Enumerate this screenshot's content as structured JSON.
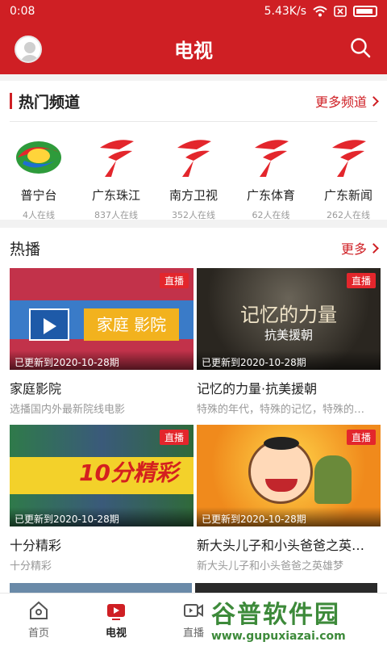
{
  "status": {
    "time": "0:08",
    "speed": "5.43K/s"
  },
  "header": {
    "title": "电视"
  },
  "channels": {
    "title": "热门频道",
    "more": "更多频道",
    "items": [
      {
        "name": "普宁台",
        "count": "4人在线",
        "logo": "puning-logo"
      },
      {
        "name": "广东珠江",
        "count": "837人在线",
        "logo": "gdtv-logo"
      },
      {
        "name": "南方卫视",
        "count": "352人在线",
        "logo": "gdtv-logo"
      },
      {
        "name": "广东体育",
        "count": "62人在线",
        "logo": "gdtv-logo"
      },
      {
        "name": "广东新闻",
        "count": "262人在线",
        "logo": "gdtv-logo"
      }
    ]
  },
  "hot": {
    "title": "热播",
    "more": "更多",
    "live_label": "直播",
    "cards": [
      {
        "title": "家庭影院",
        "desc": "选播国内外最新院线电影",
        "update": "已更新到2020-10-28期",
        "thumb_text": "家庭 影院"
      },
      {
        "title": "记忆的力量·抗美援朝",
        "desc": "特殊的年代，特殊的记忆，特殊的…",
        "update": "已更新到2020-10-28期",
        "thumb_text": "记忆的力量",
        "thumb_sub": "抗美援朝"
      },
      {
        "title": "十分精彩",
        "desc": "十分精彩",
        "update": "已更新到2020-10-28期",
        "thumb_text": "10分精彩"
      },
      {
        "title": "新大头儿子和小头爸爸之英…",
        "desc": "新大头儿子和小头爸爸之英雄梦",
        "update": "已更新到2020-10-28期",
        "thumb_text": ""
      }
    ]
  },
  "tabs": [
    {
      "label": "首页",
      "icon": "home-icon"
    },
    {
      "label": "电视",
      "icon": "tv-icon"
    },
    {
      "label": "直播",
      "icon": "video-icon"
    },
    {
      "label": "",
      "icon": ""
    },
    {
      "label": "",
      "icon": ""
    }
  ],
  "watermark": {
    "top": "谷普软件园",
    "bottom": "www.gupuxiazai.com"
  },
  "colors": {
    "brand": "#cf1f24",
    "watermark": "#3d8a3a"
  }
}
